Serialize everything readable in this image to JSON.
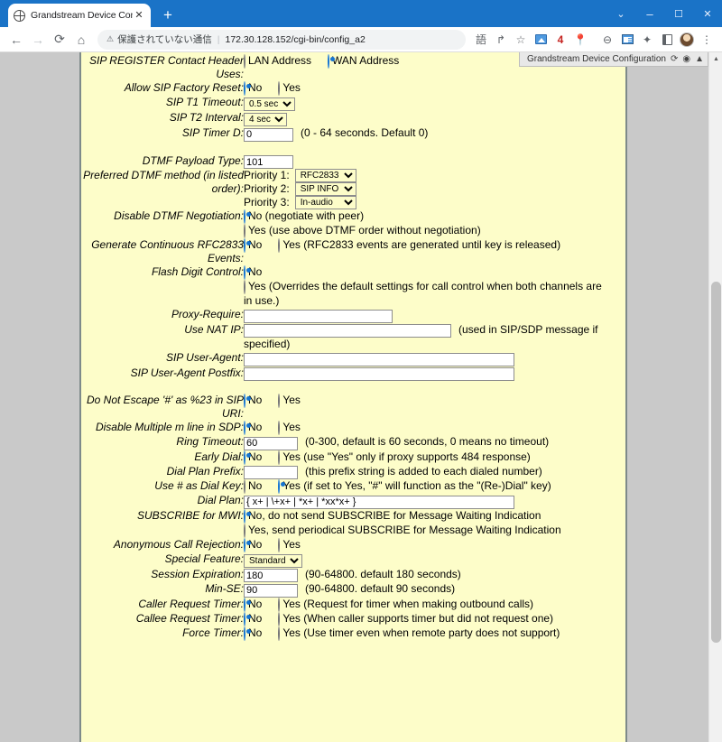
{
  "browser": {
    "tab": {
      "title": "Grandstream Device Configuratio",
      "favicon": "globe-icon",
      "close": "✕"
    },
    "newtab": "+",
    "window": {
      "chevron": "⌄",
      "minimize": "–",
      "maximize": "☐",
      "close": "✕"
    },
    "nav": {
      "back": "←",
      "forward": "→",
      "reload": "⟳",
      "home": "⌂"
    },
    "omnibox": {
      "warn_icon": "⚠",
      "warn_text": "保護されていない通信",
      "separator": "|",
      "url": "172.30.128.152/cgi-bin/config_a2"
    },
    "toolbar_icons": [
      {
        "name": "translate-icon",
        "glyph": "語"
      },
      {
        "name": "share-icon",
        "glyph": "↱"
      },
      {
        "name": "bookmark-star-icon",
        "glyph": "☆"
      },
      {
        "name": "image-extension-icon",
        "glyph": ""
      },
      {
        "name": "notification-count-badge",
        "glyph": "4"
      },
      {
        "name": "location-pin-icon",
        "glyph": "📍"
      },
      {
        "name": "chat-extension-icon",
        "glyph": "⊖"
      },
      {
        "name": "news-extension-icon",
        "glyph": ""
      },
      {
        "name": "extensions-puzzle-icon",
        "glyph": "✦"
      },
      {
        "name": "sidepanel-icon",
        "glyph": ""
      },
      {
        "name": "profile-avatar",
        "glyph": ""
      },
      {
        "name": "chrome-menu-icon",
        "glyph": "⋮"
      }
    ]
  },
  "page_badge": {
    "title": "Grandstream Device Configuration",
    "refresh_icon": "⟳",
    "eye_icon": "◉",
    "collapse_icon": "▲"
  },
  "scrollbar": {
    "up_arrow": "▲"
  },
  "form": {
    "rows": [
      {
        "label": "SIP REGISTER Contact Header Uses:",
        "type": "radio",
        "options": [
          {
            "text": "LAN Address",
            "selected": false
          },
          {
            "text": "WAN Address",
            "selected": true
          }
        ]
      },
      {
        "label": "Allow SIP Factory Reset:",
        "type": "radio",
        "options": [
          {
            "text": "No",
            "selected": true
          },
          {
            "text": "Yes",
            "selected": false
          }
        ]
      },
      {
        "label": "SIP T1 Timeout:",
        "type": "select",
        "value": "0.5 sec"
      },
      {
        "label": "SIP T2 Interval:",
        "type": "select",
        "value": "4 sec"
      },
      {
        "label": "SIP Timer D:",
        "type": "text",
        "value": "0",
        "note": "(0 - 64 seconds. Default 0)"
      },
      {
        "label": "DTMF Payload Type:",
        "type": "text",
        "value": "101",
        "note": ""
      },
      {
        "label": "Preferred DTMF method (in listed order):",
        "type": "priority",
        "priorities": [
          {
            "label": "Priority 1:",
            "value": "RFC2833"
          },
          {
            "label": "Priority 2:",
            "value": "SIP INFO"
          },
          {
            "label": "Priority 3:",
            "value": "In-audio"
          }
        ]
      },
      {
        "label": "Disable DTMF Negotiation:",
        "type": "radio",
        "options": [
          {
            "text": "No (negotiate with peer)",
            "selected": true
          },
          {
            "text": "Yes (use above DTMF order without negotiation)",
            "selected": false
          }
        ]
      },
      {
        "label": "Generate Continuous RFC2833 Events:",
        "type": "radio",
        "options": [
          {
            "text": "No",
            "selected": true
          },
          {
            "text": "Yes (RFC2833 events are generated until key is released)",
            "selected": false
          }
        ]
      },
      {
        "label": "Flash Digit Control:",
        "type": "radio",
        "options": [
          {
            "text": "No",
            "selected": true
          },
          {
            "text": "Yes  (Overrides the default settings for call control when both channels are in use.)",
            "selected": false
          }
        ]
      },
      {
        "label": "Proxy-Require:",
        "type": "text",
        "value": "",
        "note": ""
      },
      {
        "label": "Use NAT IP:",
        "type": "text",
        "value": "",
        "note": "(used in SIP/SDP message if specified)"
      },
      {
        "label": "SIP User-Agent:",
        "type": "text",
        "value": "",
        "note": ""
      },
      {
        "label": "SIP User-Agent Postfix:",
        "type": "text",
        "value": "",
        "note": ""
      },
      {
        "label": "Do Not Escape '#' as %23 in SIP URI:",
        "type": "radio",
        "options": [
          {
            "text": "No",
            "selected": true
          },
          {
            "text": "Yes",
            "selected": false
          }
        ]
      },
      {
        "label": "Disable Multiple m line in SDP:",
        "type": "radio",
        "options": [
          {
            "text": "No",
            "selected": true
          },
          {
            "text": "Yes",
            "selected": false
          }
        ]
      },
      {
        "label": "Ring Timeout:",
        "type": "text",
        "value": "60",
        "note": "(0-300, default is 60 seconds, 0 means no timeout)"
      },
      {
        "label": "Early Dial:",
        "type": "radio",
        "options": [
          {
            "text": "No",
            "selected": true
          },
          {
            "text": "Yes  (use \"Yes\" only if proxy supports 484 response)",
            "selected": false
          }
        ]
      },
      {
        "label": "Dial Plan Prefix:",
        "type": "text",
        "value": "",
        "note": "(this prefix string is added to each dialed number)"
      },
      {
        "label": "Use # as Dial Key:",
        "type": "radio",
        "options": [
          {
            "text": "No",
            "selected": false
          },
          {
            "text": "Yes  (if set to Yes, \"#\" will function as the \"(Re-)Dial\" key)",
            "selected": true
          }
        ]
      },
      {
        "label": "Dial Plan:",
        "type": "text",
        "value": "{ x+ | \\+x+ | *x+ | *xx*x+ }",
        "note": ""
      },
      {
        "label": "SUBSCRIBE for MWI:",
        "type": "radio-stack",
        "options": [
          {
            "text": "No, do not send SUBSCRIBE for Message Waiting Indication",
            "selected": true
          },
          {
            "text": "Yes, send periodical SUBSCRIBE for Message Waiting Indication",
            "selected": false
          }
        ]
      },
      {
        "label": "Anonymous Call Rejection:",
        "type": "radio",
        "options": [
          {
            "text": "No",
            "selected": true
          },
          {
            "text": "Yes",
            "selected": false
          }
        ]
      },
      {
        "label": "Special Feature:",
        "type": "select",
        "value": "Standard"
      },
      {
        "label": "Session Expiration:",
        "type": "text",
        "value": "180",
        "note": "(90-64800. default 180 seconds)"
      },
      {
        "label": "Min-SE:",
        "type": "text",
        "value": "90",
        "note": "(90-64800. default 90 seconds)"
      },
      {
        "label": "Caller Request Timer:",
        "type": "radio",
        "options": [
          {
            "text": "No",
            "selected": true
          },
          {
            "text": "Yes (Request for timer when making outbound calls)",
            "selected": false
          }
        ]
      },
      {
        "label": "Callee Request Timer:",
        "type": "radio",
        "options": [
          {
            "text": "No",
            "selected": true
          },
          {
            "text": "Yes (When caller supports timer but did not request one)",
            "selected": false
          }
        ]
      },
      {
        "label": "Force Timer:",
        "type": "radio",
        "options": [
          {
            "text": "No",
            "selected": true
          },
          {
            "text": "Yes (Use timer even when remote party does not support)",
            "selected": false
          }
        ]
      }
    ]
  },
  "colors": {
    "chrome_blue": "#1a73c7",
    "page_yellow": "#fdfdc9",
    "page_gray": "#c9c9c9",
    "radio_blue": "#1675d1"
  }
}
